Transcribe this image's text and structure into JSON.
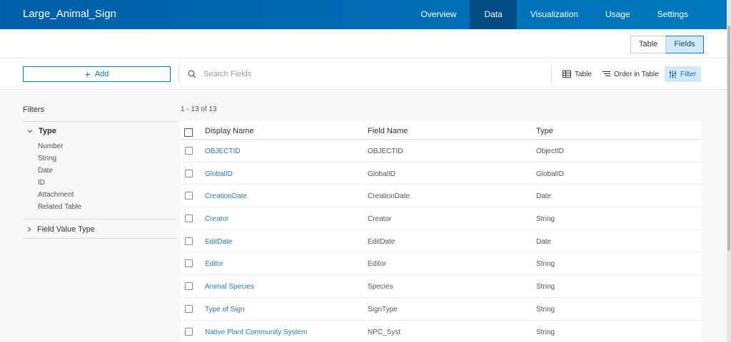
{
  "app": {
    "title": "Large_Animal_Sign"
  },
  "nav": [
    "Overview",
    "Data",
    "Visualization",
    "Usage",
    "Settings"
  ],
  "view_toggle": {
    "table": "Table",
    "fields": "Fields"
  },
  "toolbar": {
    "add_label": "Add",
    "search_placeholder": "Search Fields",
    "table_label": "Table",
    "order_label": "Order in Table",
    "filter_label": "Filter"
  },
  "filters": {
    "title": "Filters",
    "type_heading": "Type",
    "type_options": [
      "Number",
      "String",
      "Date",
      "ID",
      "Attachment",
      "Related Table"
    ],
    "field_value_type": "Field Value Type"
  },
  "results": {
    "count": "1 - 13 of 13"
  },
  "table": {
    "headers": {
      "display_name": "Display Name",
      "field_name": "Field Name",
      "type": "Type"
    },
    "rows": [
      {
        "display": "OBJECTID",
        "field": "OBJECTID",
        "type": "ObjectID"
      },
      {
        "display": "GlobalID",
        "field": "GlobalID",
        "type": "GlobalID"
      },
      {
        "display": "CreationDate",
        "field": "CreationDate",
        "type": "Date"
      },
      {
        "display": "Creator",
        "field": "Creator",
        "type": "String"
      },
      {
        "display": "EditDate",
        "field": "EditDate",
        "type": "Date"
      },
      {
        "display": "Editor",
        "field": "Editor",
        "type": "String"
      },
      {
        "display": "Animal Species",
        "field": "Species",
        "type": "String"
      },
      {
        "display": "Type of Sign",
        "field": "SignType",
        "type": "String"
      },
      {
        "display": "Native Plant Community System",
        "field": "NPC_Syst",
        "type": "String"
      }
    ]
  },
  "colors": {
    "header_blue": "#0079c1",
    "active_nav": "#004c84",
    "link": "#2a7ab8",
    "active_bg": "#d2e9f9"
  }
}
